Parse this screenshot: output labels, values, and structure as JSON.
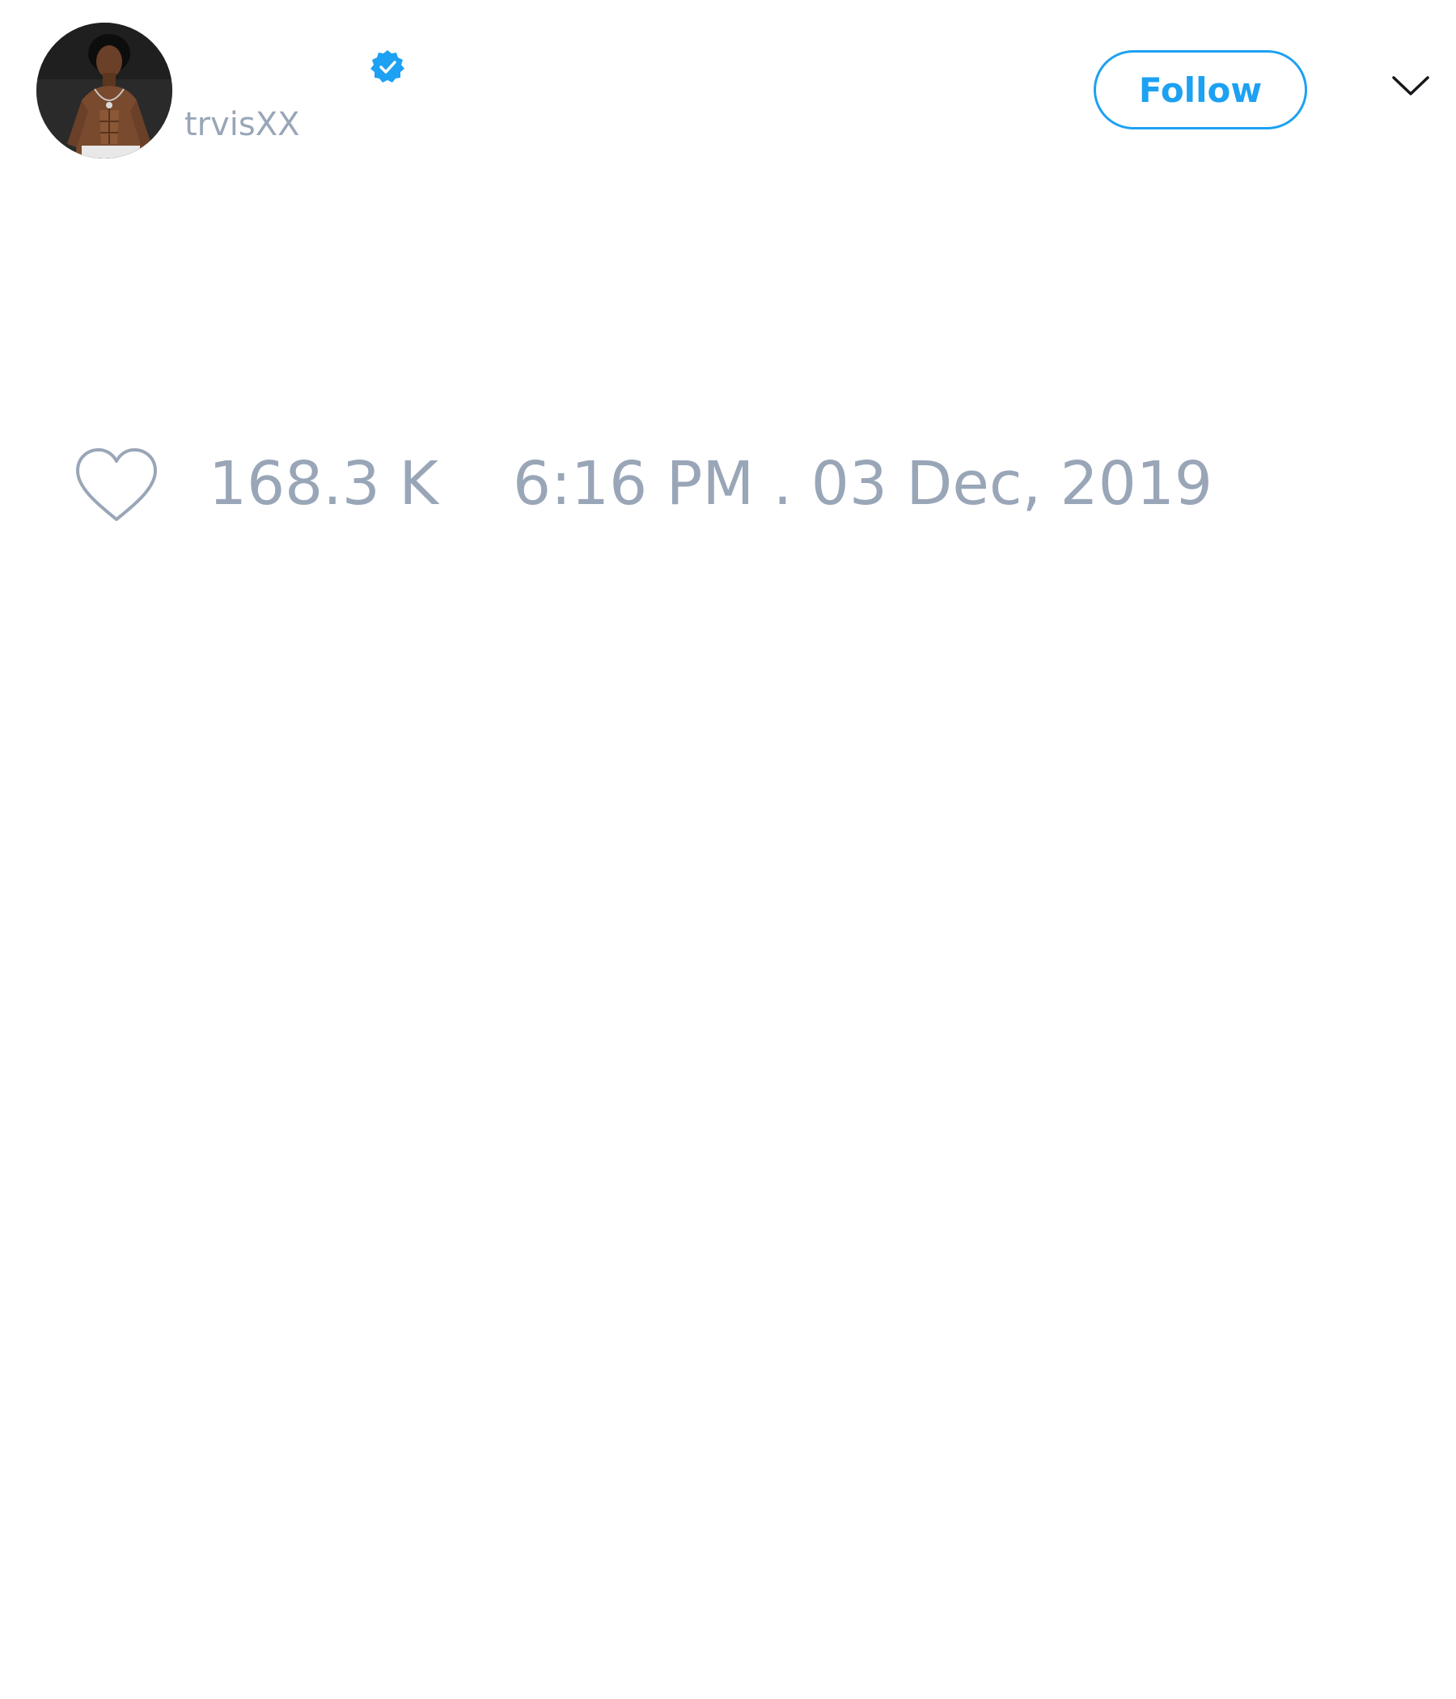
{
  "tweet": {
    "display_name": "",
    "handle": "trvisXX",
    "verified": true,
    "follow_label": "Follow",
    "likes": "168.3 K",
    "timestamp": "6:16 PM . 03 Dec, 2019"
  },
  "colors": {
    "accent": "#1da1f2",
    "muted_text": "#99a6b8",
    "background": "#ffffff"
  },
  "icons": {
    "avatar": "profile-photo",
    "verified": "verified-badge-icon",
    "more": "chevron-down-icon",
    "like": "heart-icon"
  }
}
